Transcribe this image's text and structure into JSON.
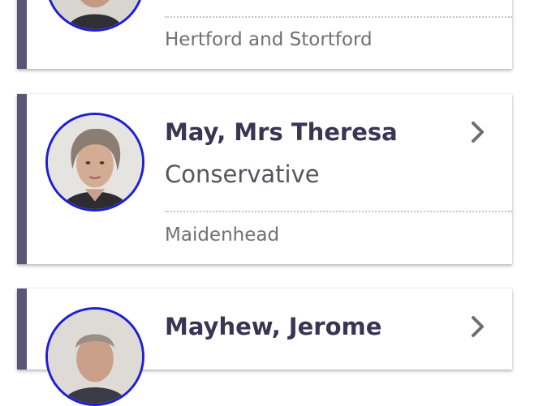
{
  "members": [
    {
      "name": "",
      "party": "",
      "constituency": "Hertford and Stortford",
      "avatar_icon": "member-portrait"
    },
    {
      "name": "May, Mrs Theresa",
      "party": "Conservative",
      "constituency": "Maidenhead",
      "avatar_icon": "member-portrait"
    },
    {
      "name": "Mayhew, Jerome",
      "party": "",
      "constituency": "",
      "avatar_icon": "member-portrait"
    }
  ],
  "icons": {
    "chevron": "chevron-right-icon"
  },
  "colors": {
    "accent_stripe": "#5b5577",
    "avatar_ring": "#1e1ed6",
    "name_text": "#3a3553",
    "party_text": "#555561",
    "constituency_text": "#707070",
    "chevron": "#6e6e6e"
  }
}
